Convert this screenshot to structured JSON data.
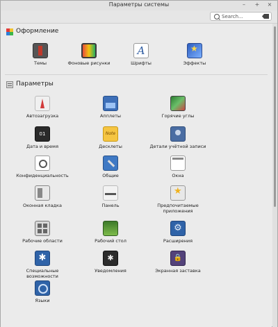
{
  "window": {
    "title": "Параметры системы",
    "minimize": "–",
    "maximize": "+",
    "close": "×"
  },
  "search": {
    "placeholder": "Search..."
  },
  "sections": [
    {
      "title": "Оформление",
      "icon": "palette-icon",
      "items": [
        {
          "label": "Темы",
          "icon": "themes-icon"
        },
        {
          "label": "Фоновые рисунки",
          "icon": "backgrounds-icon"
        },
        {
          "label": "Шрифты",
          "icon": "fonts-icon",
          "glyph": "A"
        },
        {
          "label": "Эффекты",
          "icon": "effects-icon"
        }
      ]
    },
    {
      "title": "Параметры",
      "icon": "preferences-icon",
      "items": [
        {
          "label": "Автозагрузка",
          "icon": "autostart-icon"
        },
        {
          "label": "Апплеты",
          "icon": "applets-icon"
        },
        {
          "label": "Горячие углы",
          "icon": "hot-corners-icon"
        },
        {
          "label": "Дата и время",
          "icon": "date-time-icon",
          "glyph": "01"
        },
        {
          "label": "Десклеты",
          "icon": "desklets-icon",
          "glyph": "Note"
        },
        {
          "label": "Детали учётной записи",
          "icon": "account-details-icon"
        },
        {
          "label": "Конфиденциальность",
          "icon": "privacy-icon"
        },
        {
          "label": "Общие",
          "icon": "general-icon"
        },
        {
          "label": "Окна",
          "icon": "windows-icon"
        },
        {
          "label": "Оконная кладка",
          "icon": "window-tiling-icon"
        },
        {
          "label": "Панель",
          "icon": "panel-icon"
        },
        {
          "label": "Предпочитаемые приложения",
          "icon": "preferred-apps-icon"
        },
        {
          "label": "Рабочие области",
          "icon": "workspaces-icon"
        },
        {
          "label": "Рабочий стол",
          "icon": "desktop-icon"
        },
        {
          "label": "Расширения",
          "icon": "extensions-icon",
          "glyph": "⚙"
        },
        {
          "label": "Специальные возможности",
          "icon": "accessibility-icon",
          "glyph": "✱"
        },
        {
          "label": "Уведомления",
          "icon": "notifications-icon",
          "glyph": "✱"
        },
        {
          "label": "Экранная заставка",
          "icon": "screensaver-icon",
          "glyph": "🔒"
        },
        {
          "label": "Языки",
          "icon": "languages-icon"
        }
      ]
    }
  ]
}
